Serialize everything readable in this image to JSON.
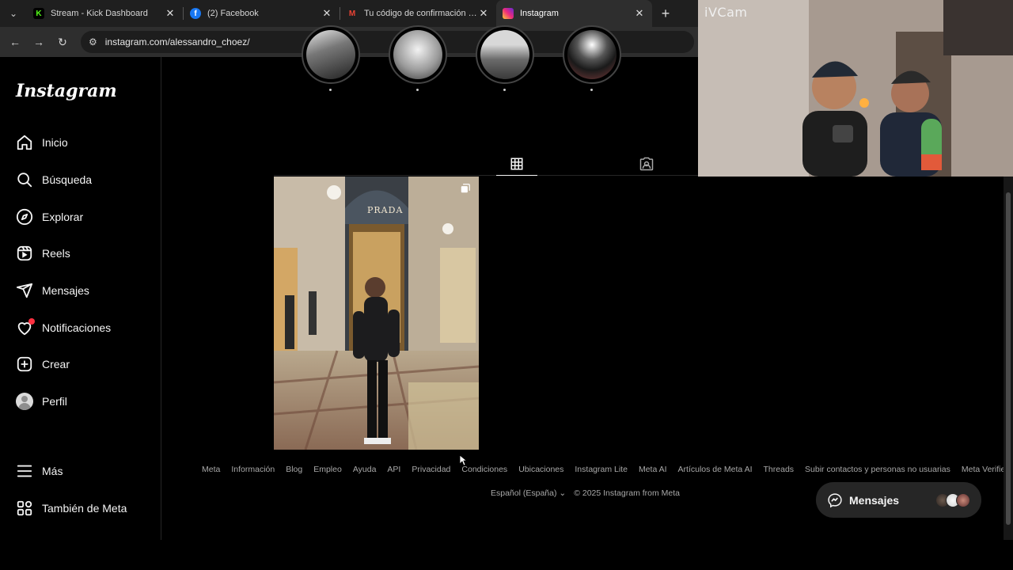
{
  "browser": {
    "tabs": [
      {
        "title": "Stream - Kick Dashboard",
        "favicon": "kick-icon",
        "active": false
      },
      {
        "title": "(2) Facebook",
        "favicon": "facebook-icon",
        "active": false
      },
      {
        "title": "Tu código de confirmación es F",
        "favicon": "gmail-icon",
        "active": false
      },
      {
        "title": "Instagram",
        "favicon": "instagram-icon",
        "active": true
      }
    ],
    "close_glyph": "✕",
    "new_tab_glyph": "+",
    "url": "instagram.com/alessandro_choez/"
  },
  "sidebar": {
    "logo": "Instagram",
    "items": [
      {
        "label": "Inicio",
        "icon": "home-icon"
      },
      {
        "label": "Búsqueda",
        "icon": "search-icon"
      },
      {
        "label": "Explorar",
        "icon": "compass-icon"
      },
      {
        "label": "Reels",
        "icon": "reels-icon"
      },
      {
        "label": "Mensajes",
        "icon": "send-icon"
      },
      {
        "label": "Notificaciones",
        "icon": "heart-icon"
      },
      {
        "label": "Crear",
        "icon": "plus-square-icon"
      },
      {
        "label": "Perfil",
        "icon": "avatar-icon"
      }
    ],
    "more": {
      "label": "Más",
      "icon": "menu-icon"
    },
    "meta": {
      "label": "También de Meta",
      "icon": "meta-apps-icon"
    }
  },
  "profile": {
    "highlights": [
      {
        "label": "."
      },
      {
        "label": "."
      },
      {
        "label": "."
      },
      {
        "label": "."
      }
    ],
    "tabs": [
      {
        "name": "posts",
        "icon": "grid-icon",
        "active": true
      },
      {
        "name": "tagged",
        "icon": "tagged-icon",
        "active": false
      }
    ],
    "posts": [
      {
        "kind": "carousel",
        "caption": "PRADA"
      }
    ]
  },
  "footer": {
    "links": [
      "Meta",
      "Información",
      "Blog",
      "Empleo",
      "Ayuda",
      "API",
      "Privacidad",
      "Condiciones",
      "Ubicaciones",
      "Instagram Lite",
      "Meta AI",
      "Artículos de Meta AI",
      "Threads",
      "Subir contactos y personas no usuarias",
      "Meta Verified"
    ],
    "language": "Español (España)",
    "copyright": "© 2025 Instagram from Meta"
  },
  "messages_pill": {
    "label": "Mensajes",
    "icon": "messenger-icon"
  },
  "webcam": {
    "label": "iVCam"
  },
  "colors": {
    "background": "#000000",
    "text": "#f5f5f5",
    "muted": "#a8a8a8",
    "notification": "#ff3040"
  }
}
